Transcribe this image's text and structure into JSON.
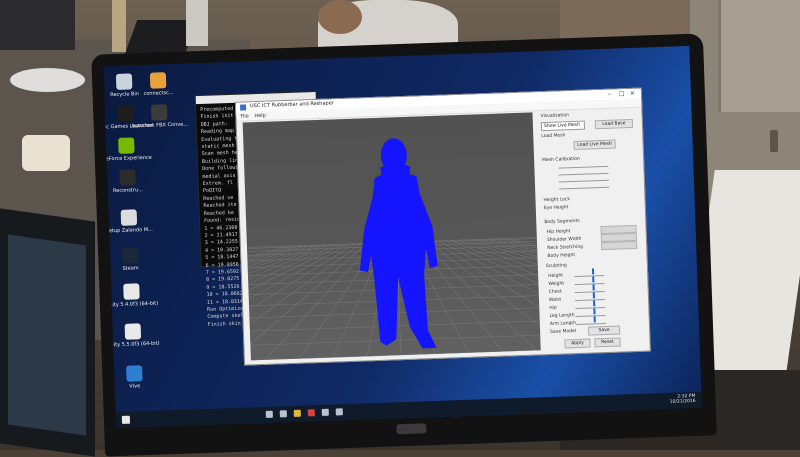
{
  "desktop": {
    "icons": [
      {
        "label": "Recycle Bin",
        "icon": "recycle-bin-icon",
        "color": "#c9d3e0"
      },
      {
        "label": "connectsc...",
        "icon": "app-icon",
        "color": "#e8a23a"
      },
      {
        "label": "Epic Games Launcher",
        "icon": "epic-games-icon",
        "color": "#1d1d1d"
      },
      {
        "label": "Autodesk FBX Conve...",
        "icon": "autodesk-icon",
        "color": "#3b3b3b"
      },
      {
        "label": "GeForce Experience",
        "icon": "geforce-icon",
        "color": "#76b900"
      },
      {
        "label": "Reconstru...",
        "icon": "app-icon",
        "color": "#2c2c2c"
      },
      {
        "label": "Setup Zalando M...",
        "icon": "setup-icon",
        "color": "#dcdcdc"
      },
      {
        "label": "Steam",
        "icon": "steam-icon",
        "color": "#1b2838"
      },
      {
        "label": "Unity 5.4.0f3 (64-bit)",
        "icon": "unity-icon",
        "color": "#e9e9e9"
      },
      {
        "label": "Unity 5.5.0f3 (64-bit)",
        "icon": "unity-icon",
        "color": "#e9e9e9"
      },
      {
        "label": "Vive",
        "icon": "vive-icon",
        "color": "#2f7fd1"
      }
    ]
  },
  "terminal": {
    "lines": [
      "Precomputed pt",
      "Finish init f",
      "OBJ path: ",
      "Reading map_pl",
      "Evaluating te",
      "static mesh",
      "Scan mesh hel",
      "Building lin",
      "Done followi",
      "medial axis",
      "Extrem. fl",
      "PoQItQ",
      "Reached ve",
      "Reached ite",
      "Reached ke",
      "Found: resid",
      "1 = 46.2300",
      "2 = 21.4917",
      "3 = 14.2255",
      "4 = 10.3827",
      "5 = 18.1447",
      "6 = 19.8958",
      "7 = 19.6592",
      "8 = 19.0275",
      "9 = 18.5526",
      "10 = 18.0662",
      "11 = 18.0314",
      "Run Optimizatio",
      "Compute skel",
      "Finish skin w"
    ]
  },
  "app": {
    "title": "USC ICT Rubberbar and Reshaper",
    "menu": [
      "File",
      "Help"
    ],
    "panel_header": "Visualization",
    "panel_labels": [
      "Show Live Mesh",
      "Load Mesh",
      "Mesh Calibration",
      "Height Lock",
      "Eye Height",
      "Body Segments",
      "Hip Height",
      "Shoulder Width",
      "Neck Stretching",
      "Body Height",
      "Sculpting",
      "Height",
      "Weight",
      "Chest",
      "Waist",
      "Hip",
      "Leg Length",
      "Arm Length",
      "Save Model"
    ],
    "button_labels": [
      "Load Base",
      "Load Live Mesh",
      "Apply",
      "Reset",
      "Save"
    ],
    "figure_color": "#1414ff"
  },
  "taskbar": {
    "time": "2:32 PM",
    "date": "10/21/2016"
  }
}
